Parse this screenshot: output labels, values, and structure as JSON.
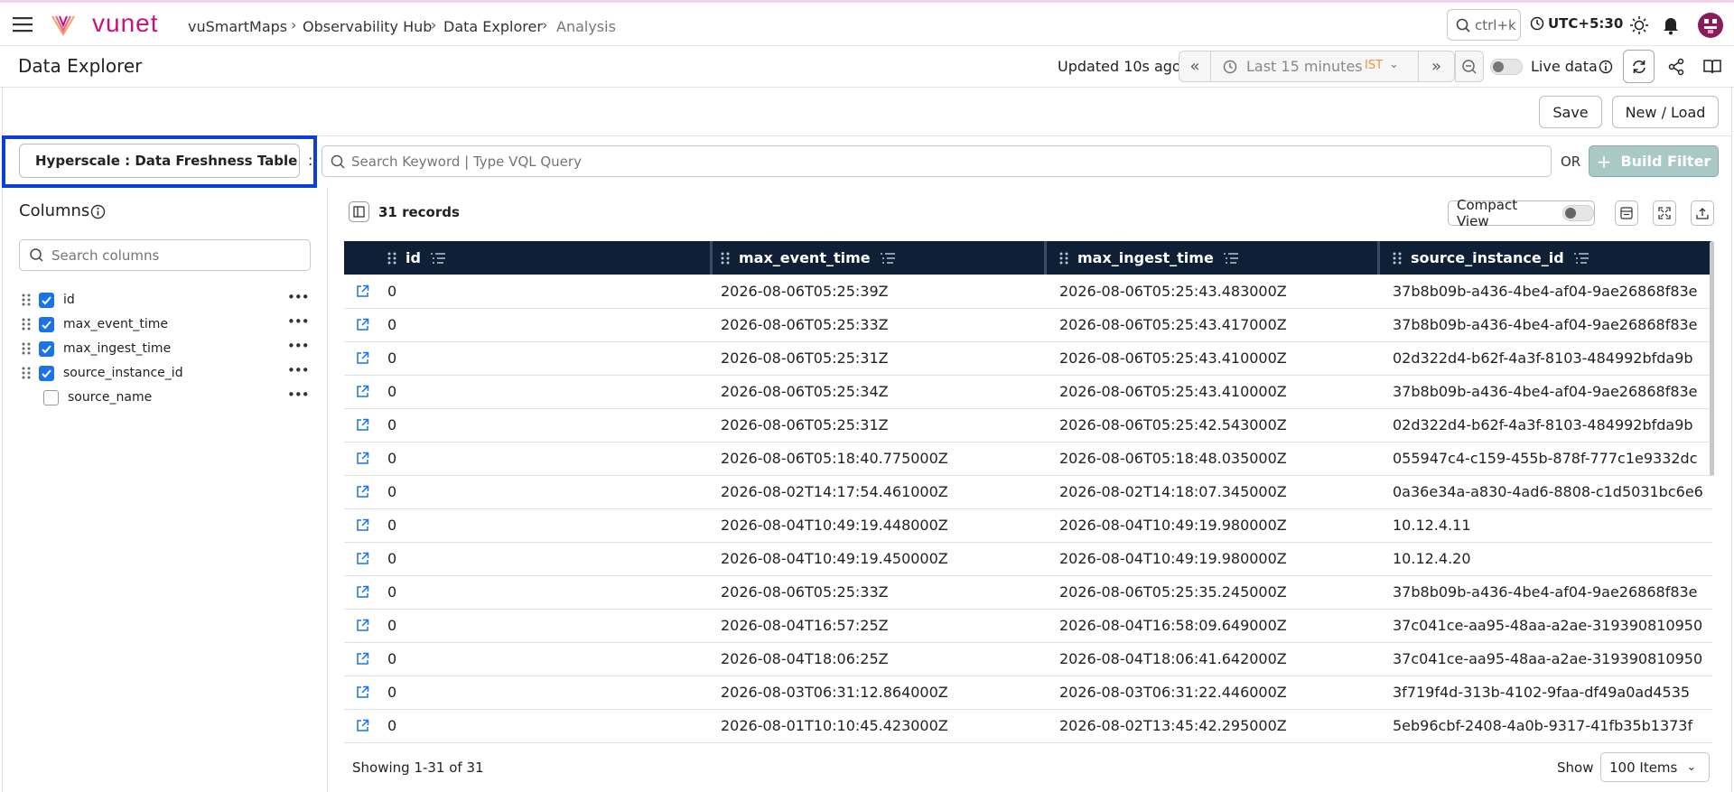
{
  "brand": {
    "logo_text": "vunet",
    "accent": "#c8127a"
  },
  "breadcrumb": [
    "vuSmartMaps",
    "Observability Hub",
    "Data Explorer",
    "Analysis"
  ],
  "search_shortcut": "ctrl+k",
  "timezone": "UTC+5:30",
  "page_title": "Data Explorer",
  "header": {
    "updated": "Updated 10s ago",
    "time_range": "Last 15 minutes",
    "time_zone_badge": "IST",
    "live_data_label": "Live data"
  },
  "actions": {
    "save": "Save",
    "new_load": "New / Load"
  },
  "dataset_name": "Hyperscale : Data Freshness Table",
  "query": {
    "placeholder": "Search Keyword | Type VQL Query",
    "or_label": "OR",
    "build_filter": "Build Filter"
  },
  "columns_panel": {
    "title": "Columns",
    "search_placeholder": "Search columns",
    "items": [
      {
        "name": "id",
        "checked": true
      },
      {
        "name": "max_event_time",
        "checked": true
      },
      {
        "name": "max_ingest_time",
        "checked": true
      },
      {
        "name": "source_instance_id",
        "checked": true
      },
      {
        "name": "source_name",
        "checked": false
      }
    ]
  },
  "table": {
    "records_label": "31 records",
    "compact_view_label": "Compact View",
    "headers": [
      "id",
      "max_event_time",
      "max_ingest_time",
      "source_instance_id"
    ],
    "rows": [
      [
        "0",
        "2026-08-06T05:25:39Z",
        "2026-08-06T05:25:43.483000Z",
        "37b8b09b-a436-4be4-af04-9ae26868f83e"
      ],
      [
        "0",
        "2026-08-06T05:25:33Z",
        "2026-08-06T05:25:43.417000Z",
        "37b8b09b-a436-4be4-af04-9ae26868f83e"
      ],
      [
        "0",
        "2026-08-06T05:25:31Z",
        "2026-08-06T05:25:43.410000Z",
        "02d322d4-b62f-4a3f-8103-484992bfda9b"
      ],
      [
        "0",
        "2026-08-06T05:25:34Z",
        "2026-08-06T05:25:43.410000Z",
        "37b8b09b-a436-4be4-af04-9ae26868f83e"
      ],
      [
        "0",
        "2026-08-06T05:25:31Z",
        "2026-08-06T05:25:42.543000Z",
        "02d322d4-b62f-4a3f-8103-484992bfda9b"
      ],
      [
        "0",
        "2026-08-06T05:18:40.775000Z",
        "2026-08-06T05:18:48.035000Z",
        "055947c4-c159-455b-878f-777c1e9332dc"
      ],
      [
        "0",
        "2026-08-02T14:17:54.461000Z",
        "2026-08-02T14:18:07.345000Z",
        "0a36e34a-a830-4ad6-8808-c1d5031bc6e6"
      ],
      [
        "0",
        "2026-08-04T10:49:19.448000Z",
        "2026-08-04T10:49:19.980000Z",
        "10.12.4.11"
      ],
      [
        "0",
        "2026-08-04T10:49:19.450000Z",
        "2026-08-04T10:49:19.980000Z",
        "10.12.4.20"
      ],
      [
        "0",
        "2026-08-06T05:25:33Z",
        "2026-08-06T05:25:35.245000Z",
        "37b8b09b-a436-4be4-af04-9ae26868f83e"
      ],
      [
        "0",
        "2026-08-04T16:57:25Z",
        "2026-08-04T16:58:09.649000Z",
        "37c041ce-aa95-48aa-a2ae-319390810950"
      ],
      [
        "0",
        "2026-08-04T18:06:25Z",
        "2026-08-04T18:06:41.642000Z",
        "37c041ce-aa95-48aa-a2ae-319390810950"
      ],
      [
        "0",
        "2026-08-03T06:31:12.864000Z",
        "2026-08-03T06:31:22.446000Z",
        "3f719f4d-313b-4102-9faa-df49a0ad4535"
      ],
      [
        "0",
        "2026-08-01T10:10:45.423000Z",
        "2026-08-02T13:45:42.295000Z",
        "5eb96cbf-2408-4a0b-9317-41fb35b1373f"
      ]
    ]
  },
  "footer": {
    "showing": "Showing 1-31 of 31",
    "show_label": "Show",
    "page_size": "100 Items"
  },
  "colors": {
    "table_header": "#0f1f36",
    "link_icon": "#1a73e8",
    "checkbox": "#1a73e8",
    "highlight_border": "#0b3fd8",
    "build_filter_bg": "#a9c9c7"
  }
}
